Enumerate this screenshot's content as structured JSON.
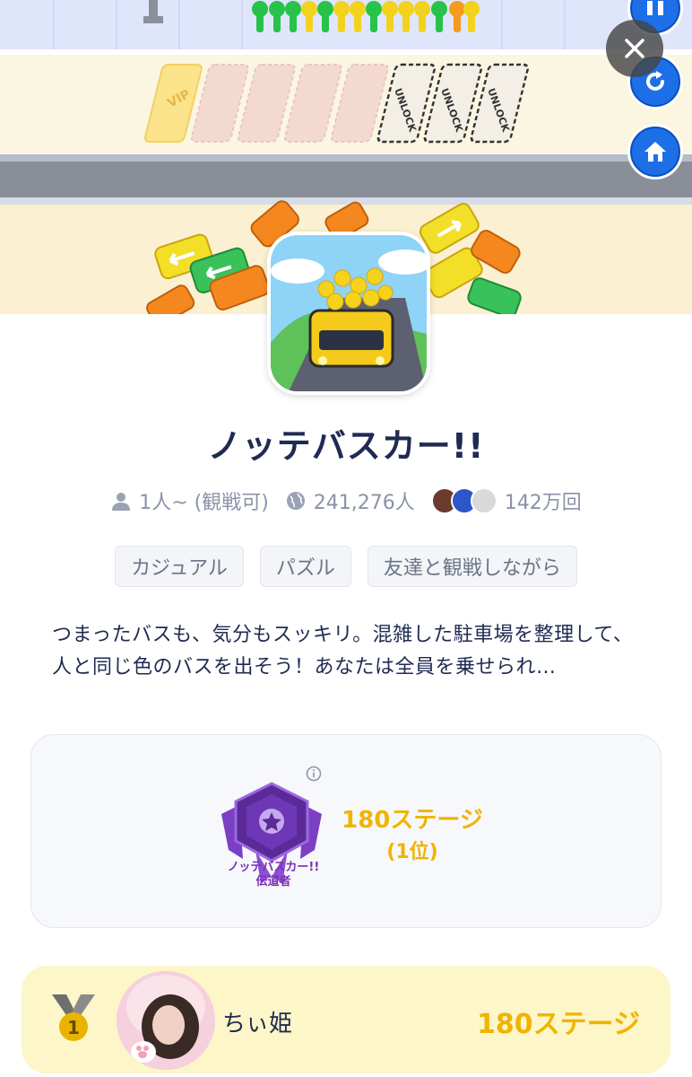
{
  "banner": {
    "vip_label": "VIP",
    "unlock_label": "UNLOCK"
  },
  "game": {
    "title": "ノッテバスカー!!",
    "players": "1人~ (観戦可)",
    "users": "241,276人",
    "plays": "142万回"
  },
  "tags": [
    "カジュアル",
    "パズル",
    "友達と観戦しながら"
  ],
  "description": "つまったバスも、気分もスッキリ。混雑した駐車場を整理して、人と同じ色のバスを出そう！あなたは全員を乗せられ…",
  "record": {
    "badge_line1": "ノッテバスカー!!",
    "badge_line2": "伝道者",
    "stages": "180ステージ",
    "rank": "(1位)"
  },
  "leaderboard": {
    "rank_number": "1",
    "player_name": "ちぃ姫",
    "score": "180ステージ"
  },
  "colors": {
    "accent_gold": "#f0b400",
    "title_navy": "#1f2b51",
    "button_blue": "#1d6fe8",
    "badge_purple": "#7a2fb5",
    "row_highlight": "#fdf6c9"
  },
  "icons": {
    "close": "close-icon",
    "refresh": "refresh-icon",
    "home": "home-icon",
    "players": "person-icon",
    "users": "globe-icon",
    "info": "info-icon"
  }
}
